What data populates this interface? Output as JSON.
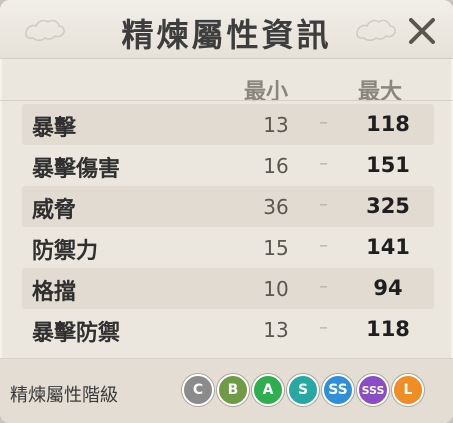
{
  "window": {
    "title": "精煉屬性資訊"
  },
  "columns": {
    "min": "最小",
    "max": "最大"
  },
  "rows": [
    {
      "label": "暴擊",
      "min": "13",
      "dash": "–",
      "max": "118"
    },
    {
      "label": "暴擊傷害",
      "min": "16",
      "dash": "–",
      "max": "151"
    },
    {
      "label": "威脅",
      "min": "36",
      "dash": "–",
      "max": "325"
    },
    {
      "label": "防禦力",
      "min": "15",
      "dash": "–",
      "max": "141"
    },
    {
      "label": "格擋",
      "min": "10",
      "dash": "–",
      "max": "94"
    },
    {
      "label": "暴擊防禦",
      "min": "13",
      "dash": "–",
      "max": "118"
    }
  ],
  "footer": {
    "label": "精煉屬性階級",
    "grades": [
      {
        "text": "C",
        "color": "#8b8b8b"
      },
      {
        "text": "B",
        "color": "#6f9b46"
      },
      {
        "text": "A",
        "color": "#2fae4f"
      },
      {
        "text": "S",
        "color": "#27a8a3"
      },
      {
        "text": "SS",
        "color": "#2f8fd8"
      },
      {
        "text": "SSS",
        "color": "#8b4dc6"
      },
      {
        "text": "L",
        "color": "#f08d24"
      }
    ]
  }
}
